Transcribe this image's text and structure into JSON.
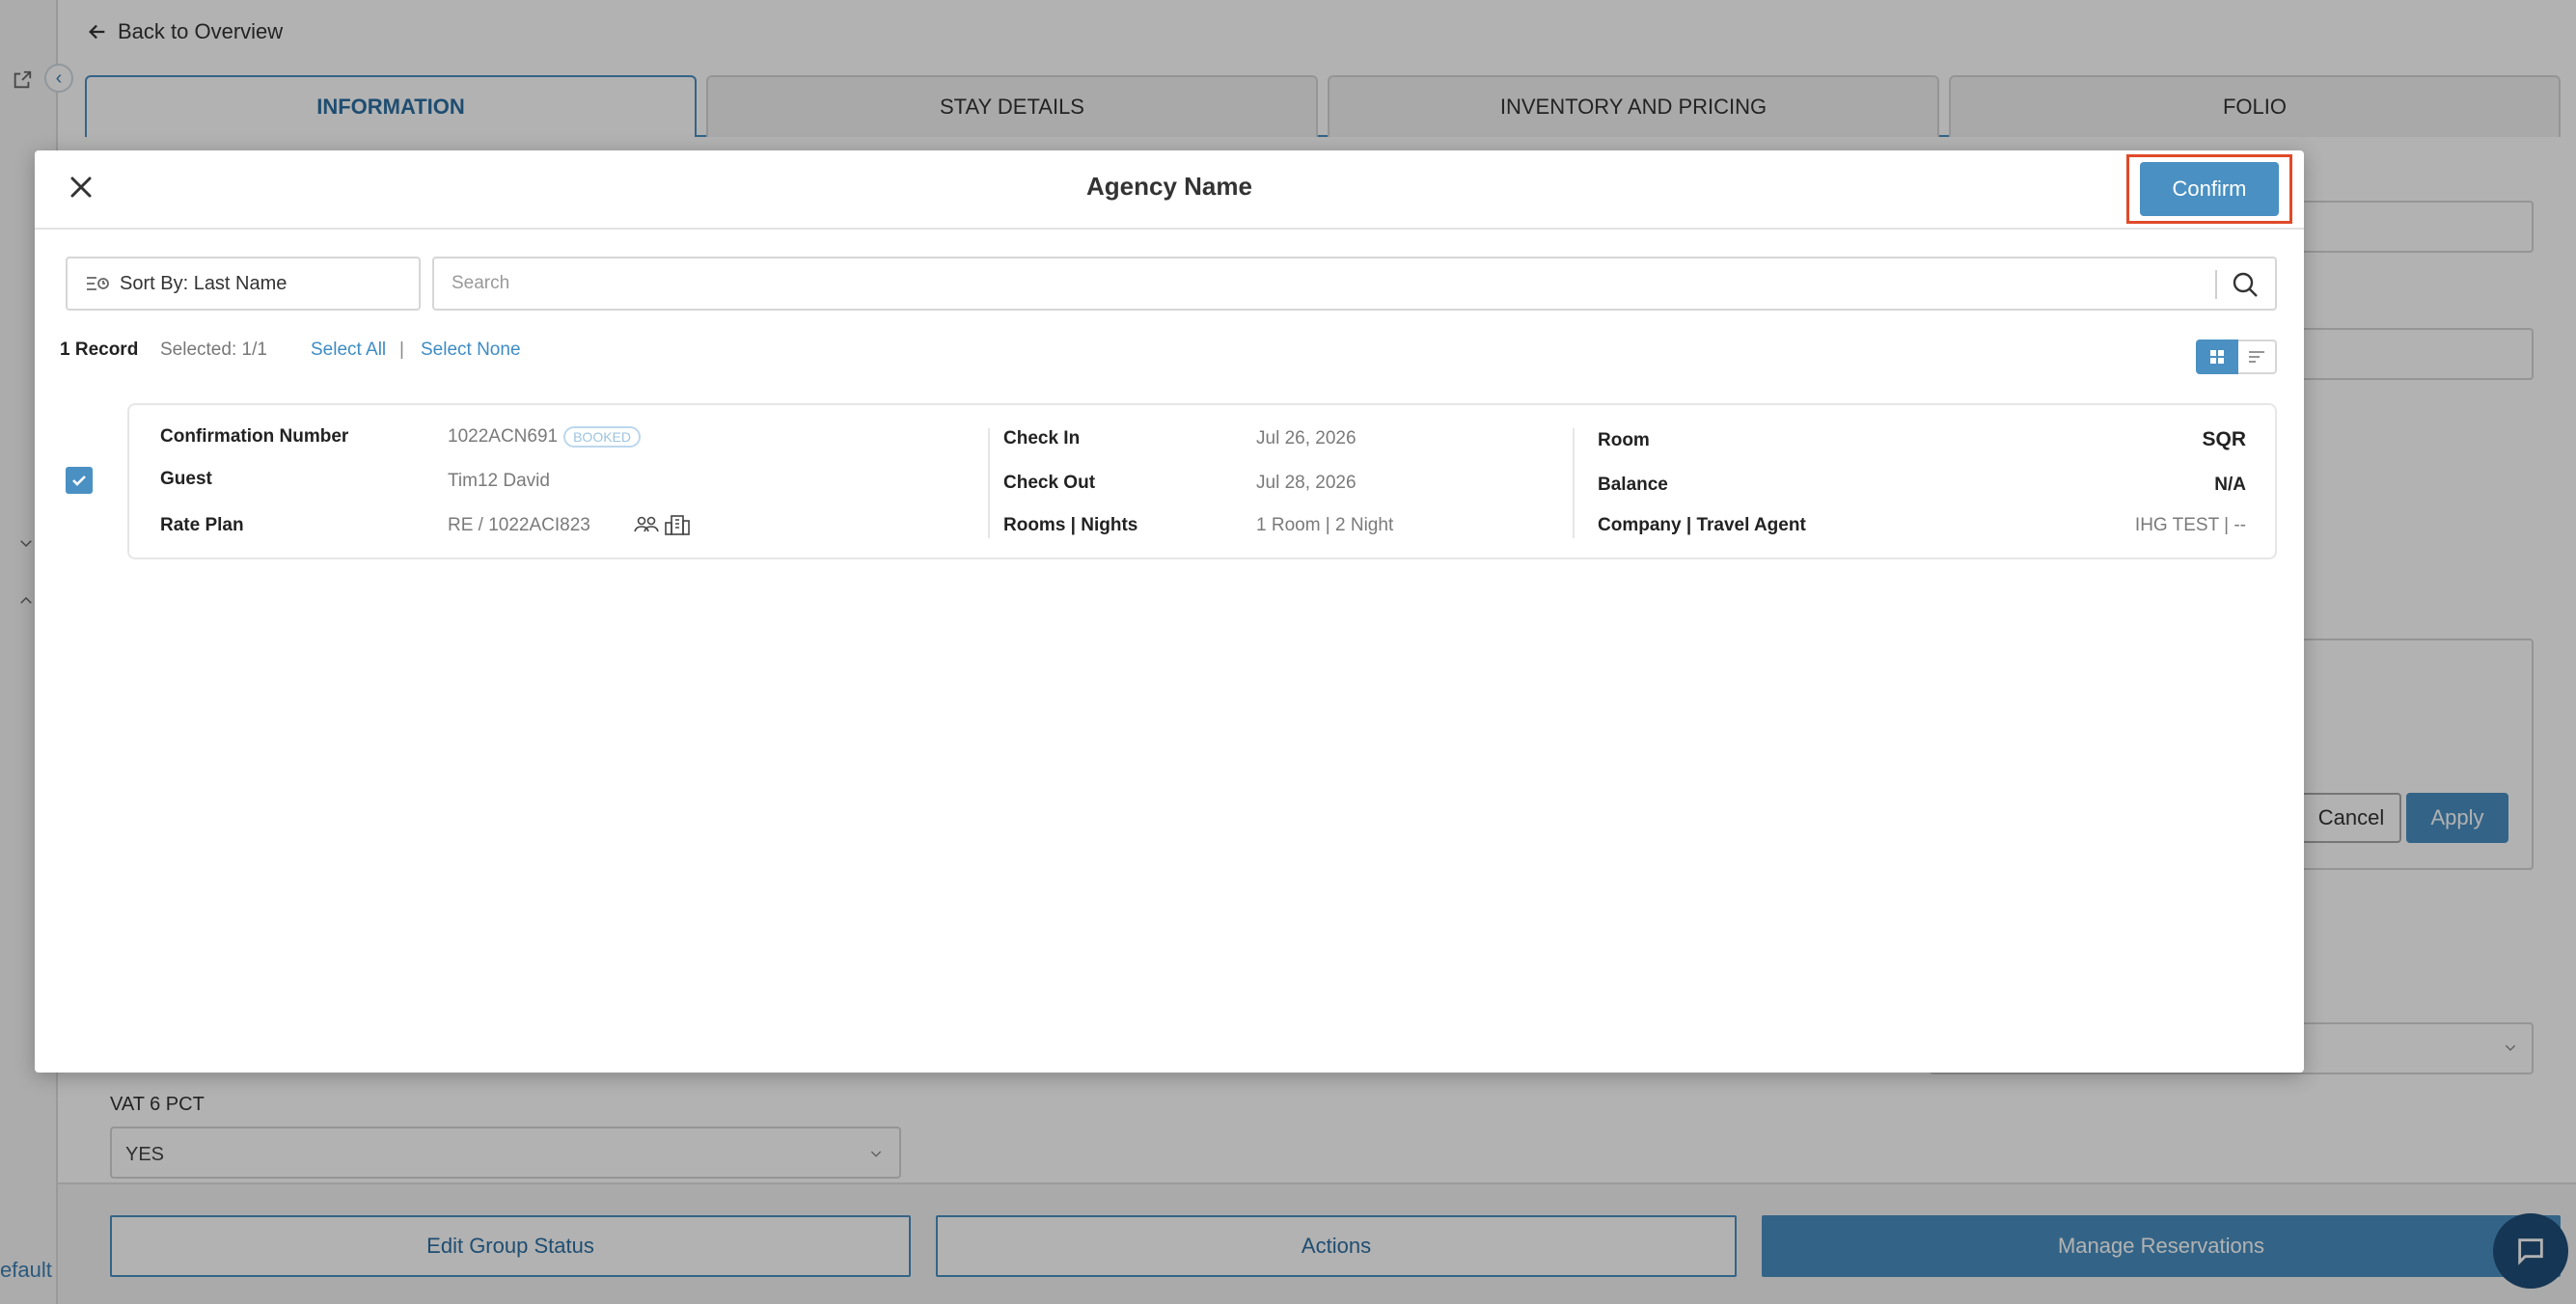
{
  "page": {
    "back_link": "Back to Overview",
    "tabs": [
      "INFORMATION",
      "STAY DETAILS",
      "INVENTORY AND PRICING",
      "FOLIO"
    ],
    "vat_label": "VAT 6 PCT",
    "vat_value": "YES",
    "cancel_label": "Cancel",
    "apply_label": "Apply",
    "rail_default_text": "efault",
    "bottom_actions": {
      "edit_group_status": "Edit Group Status",
      "actions": "Actions",
      "manage_reservations": "Manage Reservations"
    }
  },
  "modal": {
    "title": "Agency Name",
    "confirm_label": "Confirm",
    "sort_label": "Sort By: Last Name",
    "search_placeholder": "Search",
    "record_count": "1 Record",
    "selected": "Selected: 1/1",
    "select_all": "Select All",
    "separator": "|",
    "select_none": "Select None",
    "reservation": {
      "checked": true,
      "labels": {
        "confirmation_number": "Confirmation Number",
        "guest": "Guest",
        "rate_plan": "Rate Plan",
        "check_in": "Check In",
        "check_out": "Check Out",
        "rooms_nights": "Rooms | Nights",
        "room": "Room",
        "balance": "Balance",
        "company_travel_agent": "Company | Travel Agent"
      },
      "values": {
        "confirmation_number": "1022ACN691",
        "status_badge": "BOOKED",
        "guest": "Tim12 David",
        "rate_plan": "RE / 1022ACI823",
        "check_in": "Jul 26, 2026",
        "check_out": "Jul 28, 2026",
        "rooms_nights": "1 Room | 2 Night",
        "room": "SQR",
        "balance": "N/A",
        "company_travel_agent": "IHG TEST | --"
      }
    }
  },
  "colors": {
    "accent": "#4a90c2",
    "confirm_highlight": "#e04a2a",
    "overlay": "rgba(0,0,0,0.3)"
  },
  "icons": [
    "arrow-left-icon",
    "external-link-icon",
    "chevron-left-icon",
    "close-icon",
    "sort-icon",
    "search-icon",
    "grid-view-icon",
    "list-view-icon",
    "checkmark-icon",
    "group-icon",
    "building-icon",
    "chat-icon",
    "chevron-down-icon"
  ]
}
